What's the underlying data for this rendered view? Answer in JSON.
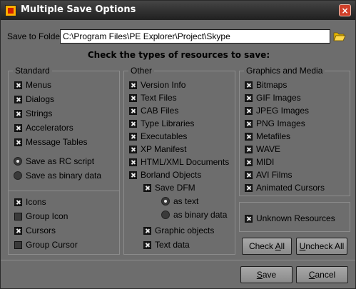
{
  "window": {
    "title": "Multiple Save Options",
    "close_glyph": "×"
  },
  "folder": {
    "label": "Save to Folder:",
    "value": "C:\\Program Files\\PE Explorer\\Project\\Skype"
  },
  "heading": "Check the types of resources to save:",
  "standard": {
    "title": "Standard",
    "items": [
      {
        "label": "Menus",
        "checked": true
      },
      {
        "label": "Dialogs",
        "checked": true
      },
      {
        "label": "Strings",
        "checked": true
      },
      {
        "label": "Accelerators",
        "checked": true
      },
      {
        "label": "Message Tables",
        "checked": true
      }
    ],
    "radios": [
      {
        "label": "Save as RC script",
        "selected": true
      },
      {
        "label": "Save as binary data",
        "selected": false
      }
    ],
    "items2": [
      {
        "label": "Icons",
        "checked": true
      },
      {
        "label": "Group Icon",
        "checked": false
      },
      {
        "label": "Cursors",
        "checked": true
      },
      {
        "label": "Group Cursor",
        "checked": false
      }
    ]
  },
  "other": {
    "title": "Other",
    "items": [
      {
        "label": "Version Info",
        "checked": true
      },
      {
        "label": "Text Files",
        "checked": true
      },
      {
        "label": "CAB Files",
        "checked": true
      },
      {
        "label": "Type Libraries",
        "checked": true
      },
      {
        "label": "Executables",
        "checked": true
      },
      {
        "label": "XP Manifest",
        "checked": true
      },
      {
        "label": "HTML/XML Documents",
        "checked": true
      },
      {
        "label": "Borland Objects",
        "checked": true
      }
    ],
    "save_dfm": {
      "label": "Save DFM",
      "checked": true
    },
    "dfm_radios": [
      {
        "label": "as text",
        "selected": true
      },
      {
        "label": "as binary data",
        "selected": false
      }
    ],
    "items2": [
      {
        "label": "Graphic objects",
        "checked": true
      },
      {
        "label": "Text data",
        "checked": true
      }
    ]
  },
  "graphics": {
    "title": "Graphics and Media",
    "items": [
      {
        "label": "Bitmaps",
        "checked": true
      },
      {
        "label": "GIF Images",
        "checked": true
      },
      {
        "label": "JPEG Images",
        "checked": true
      },
      {
        "label": "PNG Images",
        "checked": true
      },
      {
        "label": "Metafiles",
        "checked": true
      },
      {
        "label": "WAVE",
        "checked": true
      },
      {
        "label": "MIDI",
        "checked": true
      },
      {
        "label": "AVI Films",
        "checked": true
      },
      {
        "label": "Animated Cursors",
        "checked": true
      }
    ]
  },
  "unknown": {
    "label": "Unknown Resources",
    "checked": true
  },
  "buttons": {
    "check_all": {
      "pre": "Check ",
      "ul": "A",
      "post": "ll"
    },
    "uncheck_all": {
      "pre": "",
      "ul": "U",
      "post": "ncheck All"
    },
    "save": {
      "pre": "",
      "ul": "S",
      "post": "ave"
    },
    "cancel": {
      "pre": "",
      "ul": "C",
      "post": "ancel"
    }
  },
  "icons": {
    "folder": "open-folder-icon",
    "app": "pe-explorer-app-icon"
  },
  "colors": {
    "window_bg": "#6d6d6d",
    "titlebar": "#202020",
    "close": "#d0402a"
  }
}
